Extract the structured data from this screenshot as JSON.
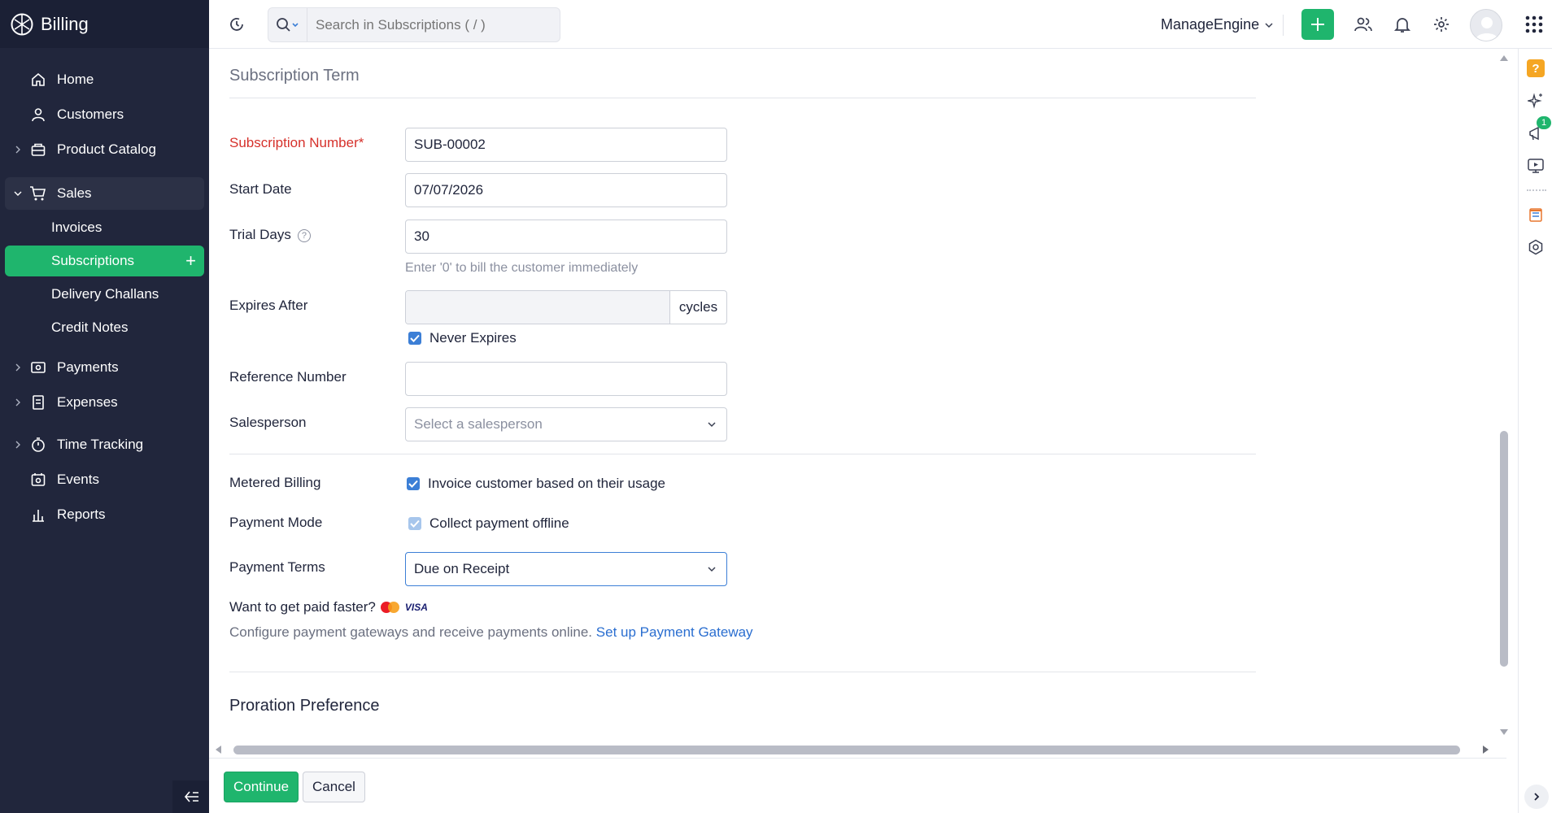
{
  "app": {
    "name": "Billing"
  },
  "sidebar": {
    "items": [
      {
        "label": "Home",
        "icon": "home-icon"
      },
      {
        "label": "Customers",
        "icon": "user-icon"
      },
      {
        "label": "Product Catalog",
        "icon": "catalog-icon"
      },
      {
        "label": "Sales",
        "icon": "cart-icon"
      },
      {
        "label": "Payments",
        "icon": "payments-icon"
      },
      {
        "label": "Expenses",
        "icon": "receipt-icon"
      },
      {
        "label": "Time Tracking",
        "icon": "stopwatch-icon"
      },
      {
        "label": "Events",
        "icon": "calendar-icon"
      },
      {
        "label": "Reports",
        "icon": "chart-icon"
      }
    ],
    "sales_sub": [
      {
        "label": "Invoices"
      },
      {
        "label": "Subscriptions"
      },
      {
        "label": "Delivery Challans"
      },
      {
        "label": "Credit Notes"
      }
    ],
    "add_symbol": "+"
  },
  "topbar": {
    "search_placeholder": "Search in Subscriptions ( / )",
    "org_name": "ManageEngine",
    "accent": "#1fb56d"
  },
  "form": {
    "section_title": "Subscription Term",
    "subscription_number": {
      "label": "Subscription Number*",
      "value": "SUB-00002"
    },
    "start_date": {
      "label": "Start Date",
      "value": "07/07/2026"
    },
    "trial_days": {
      "label": "Trial Days",
      "value": "30",
      "hint": "Enter '0' to bill the customer immediately",
      "help": "?"
    },
    "expires_after": {
      "label": "Expires After",
      "value": "",
      "suffix": "cycles",
      "never_expires": "Never Expires"
    },
    "reference_number": {
      "label": "Reference Number",
      "value": ""
    },
    "salesperson": {
      "label": "Salesperson",
      "placeholder": "Select a salesperson"
    },
    "metered_billing": {
      "label": "Metered Billing",
      "option": "Invoice customer based on their usage"
    },
    "payment_mode": {
      "label": "Payment Mode",
      "option": "Collect payment offline"
    },
    "payment_terms": {
      "label": "Payment Terms",
      "value": "Due on Receipt"
    },
    "gateway": {
      "question": "Want to get paid faster?",
      "text": "Configure payment gateways and receive payments online.",
      "link": "Set up Payment Gateway",
      "visa": "VISA"
    },
    "proration_title": "Proration Preference"
  },
  "footer": {
    "continue": "Continue",
    "cancel": "Cancel"
  },
  "rail": {
    "badge": "1"
  }
}
